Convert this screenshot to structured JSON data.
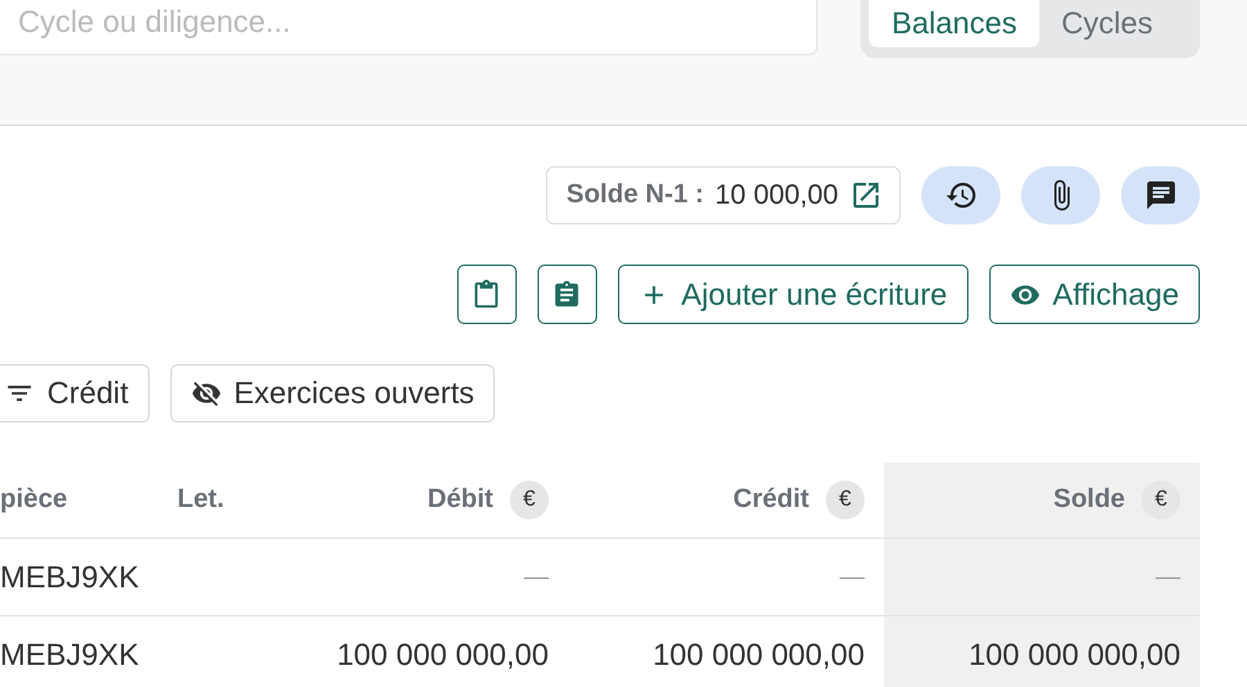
{
  "search": {
    "placeholder": "Cycle ou diligence..."
  },
  "view_toggle": [
    {
      "label": "Balances",
      "selected": true
    },
    {
      "label": "Cycles",
      "selected": false
    }
  ],
  "solde_n1": {
    "label": "Solde N-1 :",
    "value": "10 000,00"
  },
  "round_actions": [
    {
      "kind": "history"
    },
    {
      "kind": "attachment"
    },
    {
      "kind": "comment"
    }
  ],
  "toolbar": [
    {
      "kind": "clipboard"
    },
    {
      "kind": "clipboard-edit"
    },
    {
      "kind": "add",
      "label": "Ajouter une écriture"
    },
    {
      "kind": "view",
      "label": "Affichage"
    }
  ],
  "filters": [
    {
      "kind": "filter",
      "label": "Crédit"
    },
    {
      "kind": "hidden",
      "label": "Exercices ouverts"
    }
  ],
  "table": {
    "columns": [
      {
        "label": "pièce",
        "shaded": false
      },
      {
        "label": "Let.",
        "shaded": false
      },
      {
        "label": "Débit",
        "currency": "€",
        "shaded": false
      },
      {
        "label": "Crédit",
        "currency": "€",
        "shaded": false
      },
      {
        "label": "Solde",
        "currency": "€",
        "shaded": true
      }
    ],
    "rows": [
      [
        "MEBJ9XK",
        "",
        "—",
        "—",
        "—"
      ],
      [
        "MEBJ9XK",
        "",
        "100 000 000,00",
        "100 000 000,00",
        "100 000 000,00"
      ]
    ]
  }
}
